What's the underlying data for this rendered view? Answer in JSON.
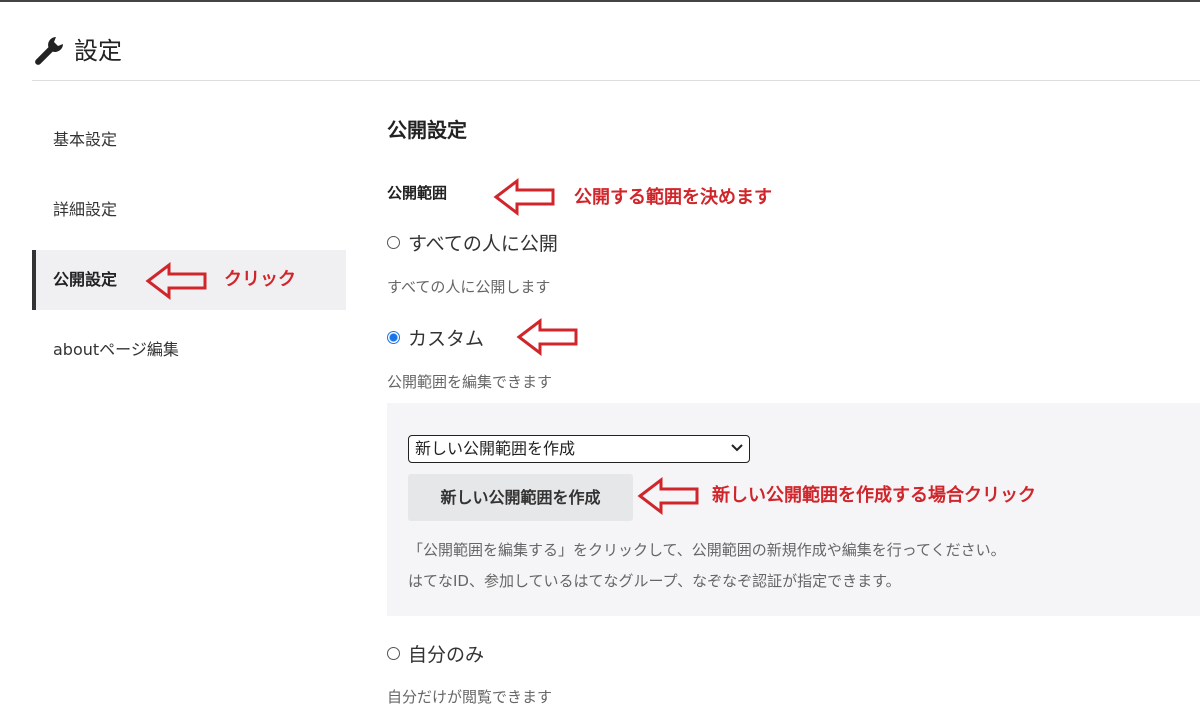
{
  "header": {
    "title": "設定",
    "icon": "wrench-icon"
  },
  "sidebar": {
    "items": [
      {
        "label": "基本設定",
        "active": false
      },
      {
        "label": "詳細設定",
        "active": false
      },
      {
        "label": "公開設定",
        "active": true
      },
      {
        "label": "aboutページ編集",
        "active": false
      }
    ]
  },
  "main": {
    "title": "公開設定",
    "section_label": "公開範囲",
    "options": [
      {
        "label": "すべての人に公開",
        "description": "すべての人に公開します",
        "checked": false
      },
      {
        "label": "カスタム",
        "description": "公開範囲を編集できます",
        "checked": true
      },
      {
        "label": "自分のみ",
        "description": "自分だけが閲覧できます",
        "checked": false
      }
    ],
    "custom_panel": {
      "select_value": "新しい公開範囲を作成",
      "create_button_label": "新しい公開範囲を作成",
      "note_line1": "「公開範囲を編集する」をクリックして、公開範囲の新規作成や編集を行ってください。",
      "note_line2": "はてなID、参加しているはてなグループ、なぞなぞ認証が指定できます。"
    }
  },
  "annotations": {
    "click": "クリック",
    "decide_scope": "公開する範囲を決めます",
    "create_new": "新しい公開範囲を作成する場合クリック",
    "color": "#d0262b"
  },
  "colors": {
    "accent": "#1a73e8",
    "active_bg": "#f0f0f2",
    "panel_bg": "#f5f5f7",
    "button_bg": "#e6e7e9"
  }
}
